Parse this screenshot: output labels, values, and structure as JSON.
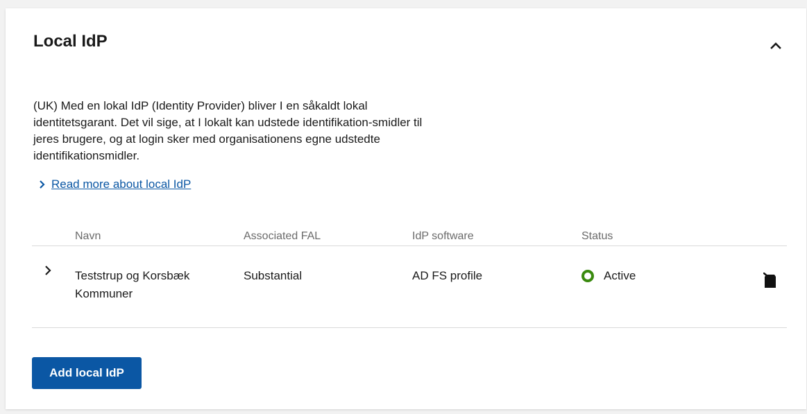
{
  "section": {
    "title": "Local IdP",
    "description": "(UK) Med en lokal IdP (Identity Provider) bliver I en såkaldt lokal identitetsgarant. Det vil sige, at I lokalt kan udstede identifikation-smidler til jeres brugere, og at login sker med organisationens egne udstedte identifikationsmidler.",
    "read_more_link": "Read more about local IdP",
    "collapse_icon": "chevron-up-icon"
  },
  "table": {
    "columns": [
      "Navn",
      "Associated FAL",
      "IdP software",
      "Status"
    ],
    "rows": [
      {
        "name_line1": "Teststrup og Korsbæk",
        "name_line2": "Kommuner",
        "fal": "Substantial",
        "software": "AD FS profile",
        "status": "Active",
        "status_color": "#3a8a0f",
        "expand_icon": "chevron-right-icon",
        "action_icon": "delete-icon"
      }
    ]
  },
  "actions": {
    "add_label": "Add local IdP",
    "add_color": "#0b57a4"
  },
  "colors": {
    "link": "#0b57a4",
    "header_text": "#6b6b6b",
    "divider": "#d9d9d9"
  }
}
